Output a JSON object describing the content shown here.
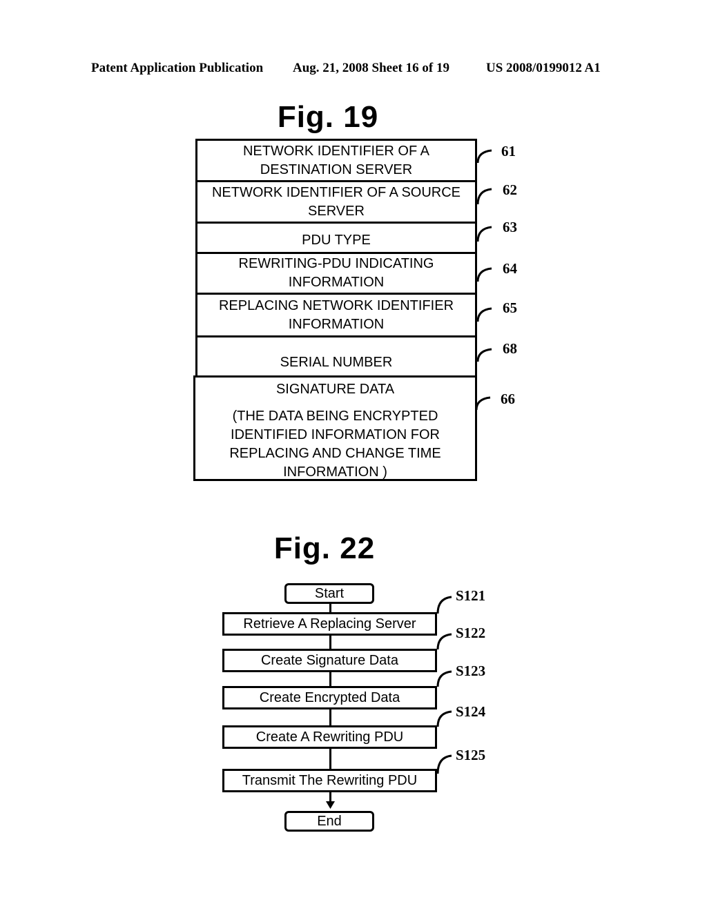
{
  "header": {
    "left": "Patent Application Publication",
    "center": "Aug. 21, 2008  Sheet 16 of 19",
    "right": "US 2008/0199012 A1"
  },
  "fig19": {
    "title": "Fig. 19",
    "fields": [
      {
        "text": "NETWORK IDENTIFIER  OF A DESTINATION SERVER",
        "ref": "61"
      },
      {
        "text": "NETWORK IDENTIFIER OF A SOURCE SERVER",
        "ref": "62"
      },
      {
        "text": "PDU TYPE",
        "ref": "63"
      },
      {
        "text": "REWRITING-PDU INDICATING INFORMATION",
        "ref": "64"
      },
      {
        "text": "REPLACING NETWORK IDENTIFIER INFORMATION",
        "ref": "65"
      },
      {
        "text": "SERIAL NUMBER",
        "ref": "68"
      },
      {
        "text": "SIGNATURE DATA",
        "subtext": "(THE DATA BEING ENCRYPTED IDENTIFIED INFORMATION FOR REPLACING AND CHANGE TIME INFORMATION )",
        "ref": "66"
      }
    ]
  },
  "fig22": {
    "title": "Fig. 22",
    "start": "Start",
    "end": "End",
    "steps": [
      {
        "text": "Retrieve A Replacing Server",
        "ref": "S121"
      },
      {
        "text": "Create Signature Data",
        "ref": "S122"
      },
      {
        "text": "Create Encrypted Data",
        "ref": "S123"
      },
      {
        "text": "Create A Rewriting PDU",
        "ref": "S124"
      },
      {
        "text": "Transmit The Rewriting PDU",
        "ref": "S125"
      }
    ]
  }
}
